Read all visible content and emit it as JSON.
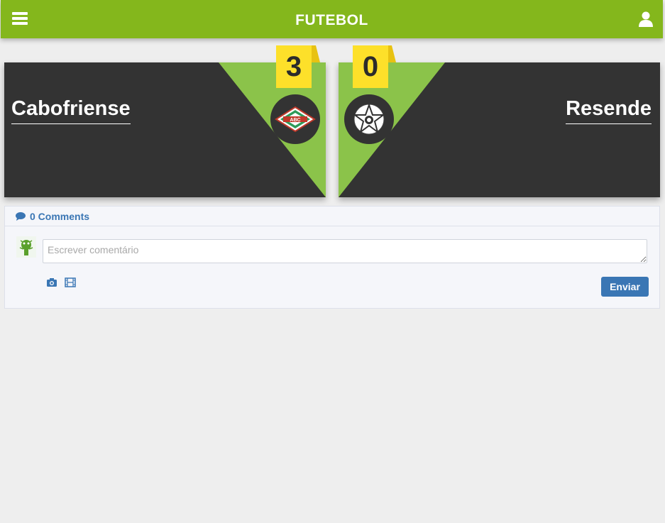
{
  "header": {
    "title": "FUTEBOL",
    "menu_icon": "hamburger-menu-icon",
    "user_icon": "user-icon"
  },
  "match": {
    "home": {
      "name": "Cabofriense",
      "score": "3",
      "crest_text": "ABC",
      "crest_icon": "diamond-crest-icon"
    },
    "away": {
      "name": "Resende",
      "score": "0",
      "crest_icon": "star-crest-icon"
    }
  },
  "comments": {
    "count_label": "0 Comments",
    "input_placeholder": "Escrever comentário",
    "photo_icon": "camera-icon",
    "video_icon": "film-icon",
    "send_label": "Enviar"
  },
  "colors": {
    "header_green": "#84b71c",
    "panel_dark": "#333333",
    "triangle_green": "#8bc34a",
    "score_yellow": "#fde02a",
    "link_blue": "#3a76b4"
  }
}
